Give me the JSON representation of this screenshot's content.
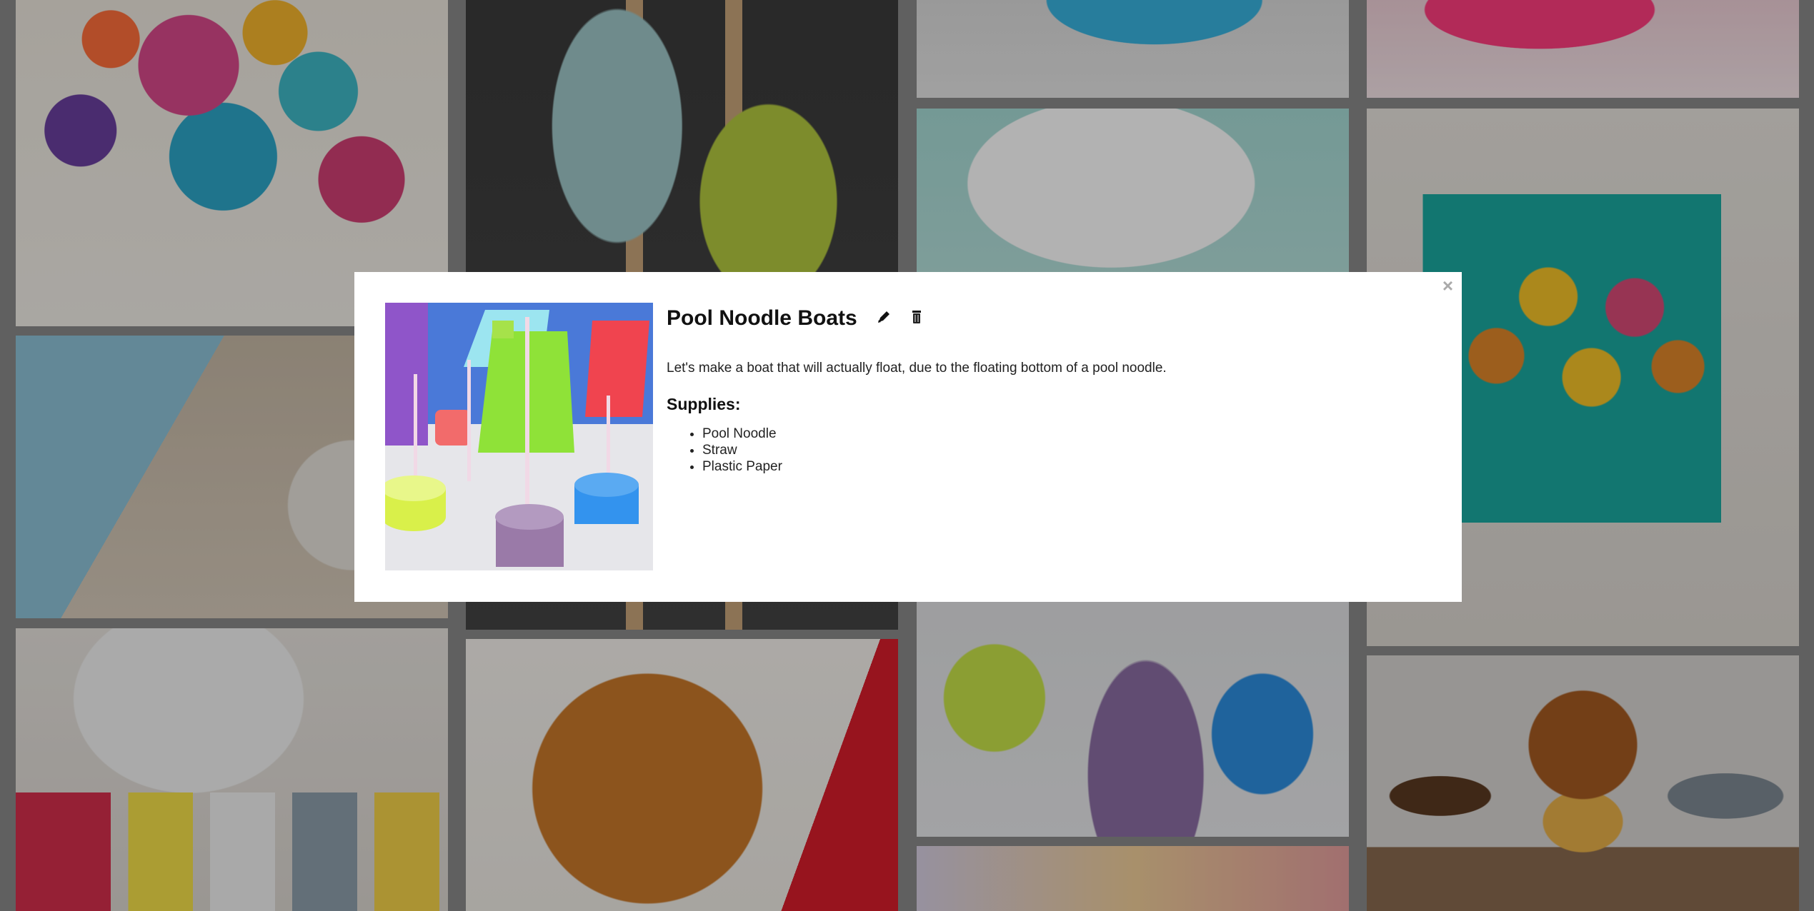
{
  "modal": {
    "title": "Pool Noodle Boats",
    "description": "Let's make a boat that will actually float, due to the floating bottom of a pool noodle.",
    "supplies_heading": "Supplies:",
    "supplies": [
      "Pool Noodle",
      "Straw",
      "Plastic Paper"
    ],
    "close_symbol": "×",
    "edit_icon": "pencil-icon",
    "delete_icon": "trash-icon"
  },
  "colors": {
    "overlay": "rgba(0,0,0,0.30)",
    "modal_background": "#ffffff",
    "close_color": "#aaaaaa"
  }
}
